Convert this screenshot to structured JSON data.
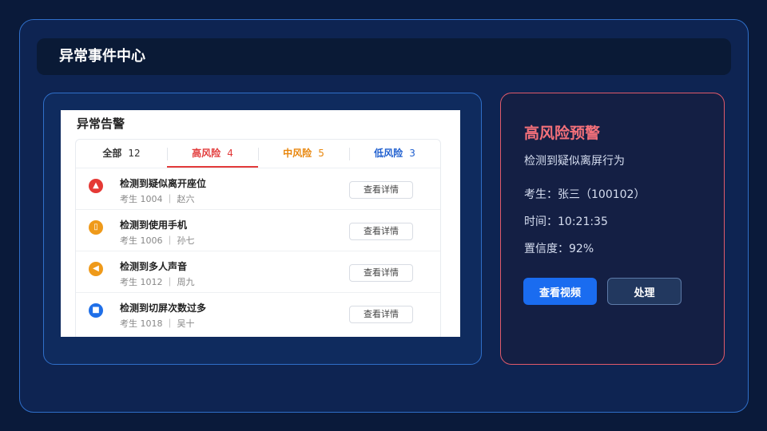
{
  "header": {
    "title": "异常事件中心"
  },
  "alert_panel": {
    "title": "异常告警",
    "tabs": [
      {
        "label": "全部",
        "count": "12"
      },
      {
        "label": "高风险",
        "count": "4"
      },
      {
        "label": "中风险",
        "count": "5"
      },
      {
        "label": "低风险",
        "count": "3"
      }
    ],
    "items": [
      {
        "title": "检测到疑似离开座位",
        "sub": "考生 1004 ｜ 赵六",
        "action": "查看详情",
        "icon": "person-alert-icon",
        "color": "#e53935"
      },
      {
        "title": "检测到使用手机",
        "sub": "考生 1006 ｜ 孙七",
        "action": "查看详情",
        "icon": "phone-icon",
        "color": "#ef9a1a"
      },
      {
        "title": "检测到多人声音",
        "sub": "考生 1012 ｜ 周九",
        "action": "查看详情",
        "icon": "speaker-icon",
        "color": "#ef9a1a"
      },
      {
        "title": "检测到切屏次数过多",
        "sub": "考生 1018 ｜ 吴十",
        "action": "查看详情",
        "icon": "screen-switch-icon",
        "color": "#1f6fe8"
      }
    ]
  },
  "detail": {
    "title": "高风险预警",
    "desc": "检测到疑似离屏行为",
    "student": "考生：张三（100102）",
    "time": "时间：10:21:35",
    "confidence": "置信度：92%",
    "view_video": "查看视频",
    "handle": "处理"
  },
  "colors": {
    "accent": "#1a6cf0",
    "high": "#e23a3a",
    "mid": "#e8860c",
    "low": "#1f5fcf",
    "alert_title": "#f3707a"
  }
}
